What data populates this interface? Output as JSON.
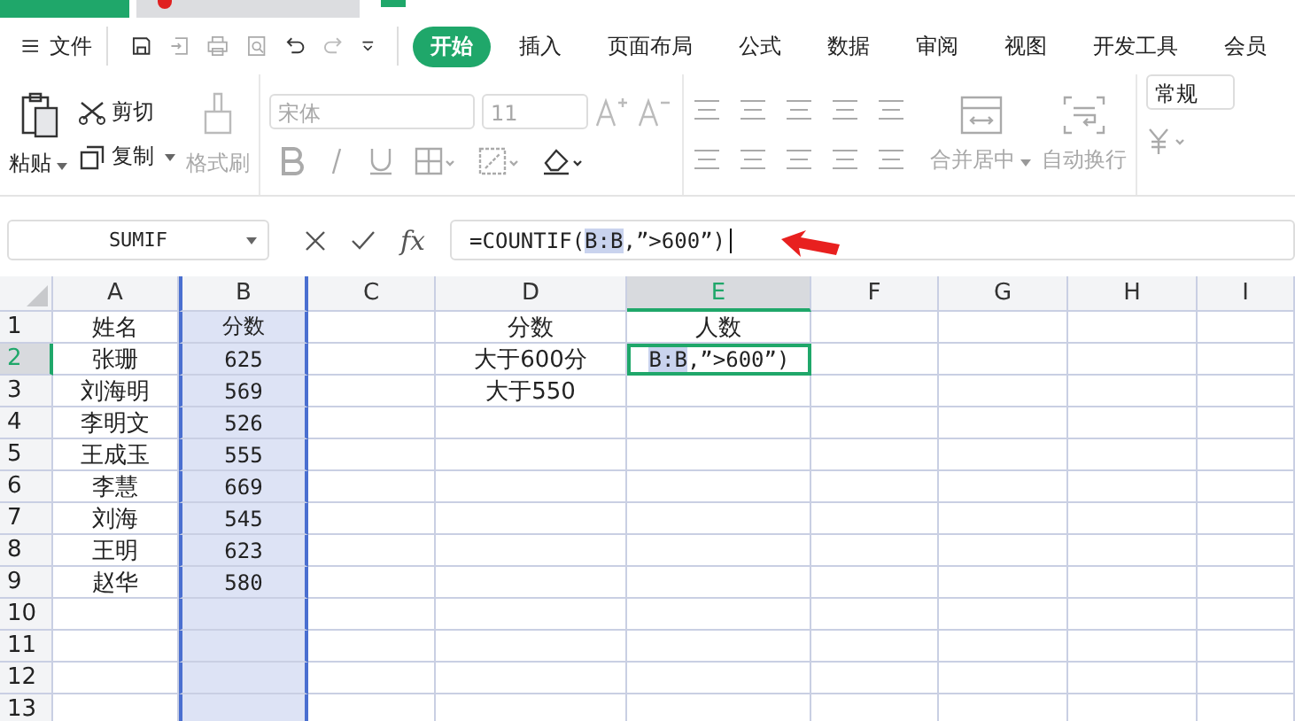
{
  "menu": {
    "file": "文件",
    "tabs": [
      {
        "label": "开始",
        "selected": true
      },
      {
        "label": "插入",
        "selected": false
      },
      {
        "label": "页面布局",
        "selected": false
      },
      {
        "label": "公式",
        "selected": false
      },
      {
        "label": "数据",
        "selected": false
      },
      {
        "label": "审阅",
        "selected": false
      },
      {
        "label": "视图",
        "selected": false
      },
      {
        "label": "开发工具",
        "selected": false
      },
      {
        "label": "会员",
        "selected": false
      }
    ]
  },
  "ribbon": {
    "paste": "粘贴",
    "cut": "剪切",
    "copy": "复制",
    "format_painter": {
      "label": "格式刷",
      "disabled": true
    },
    "font_name": {
      "value": "宋体",
      "disabled": true
    },
    "font_size": {
      "value": "11",
      "disabled": true
    },
    "merge": {
      "label": "合并居中",
      "disabled": true
    },
    "wrap": {
      "label": "自动换行",
      "disabled": true
    },
    "number_format": "常规"
  },
  "formula_bar": {
    "name_box": "SUMIF",
    "fx": "fx",
    "formula": [
      {
        "kind": "text",
        "text": "=COUNTIF("
      },
      {
        "kind": "ref",
        "text": "B:B"
      },
      {
        "kind": "text",
        "text": ",”>600”)"
      }
    ]
  },
  "sheet": {
    "columns": [
      {
        "label": "A",
        "selected": false,
        "referenced": false
      },
      {
        "label": "B",
        "selected": false,
        "referenced": true
      },
      {
        "label": "C",
        "selected": false,
        "referenced": false
      },
      {
        "label": "D",
        "selected": false,
        "referenced": false
      },
      {
        "label": "E",
        "selected": true,
        "referenced": false
      },
      {
        "label": "F",
        "selected": false,
        "referenced": false
      },
      {
        "label": "G",
        "selected": false,
        "referenced": false
      },
      {
        "label": "H",
        "selected": false,
        "referenced": false
      },
      {
        "label": "I",
        "selected": false,
        "referenced": false
      }
    ],
    "rows": [
      {
        "label": "1",
        "selected": false,
        "cells": [
          "姓名",
          "分数",
          "",
          "分数",
          "人数"
        ]
      },
      {
        "label": "2",
        "selected": true,
        "cells": [
          "张珊",
          "625",
          "",
          "大于600分",
          {
            "active": true,
            "parts": [
              {
                "kind": "ref",
                "text": "B:B"
              },
              {
                "kind": "text",
                "text": ",”>600”)"
              }
            ]
          }
        ]
      },
      {
        "label": "3",
        "selected": false,
        "cells": [
          "刘海明",
          "569",
          "",
          "大于550"
        ]
      },
      {
        "label": "4",
        "selected": false,
        "cells": [
          "李明文",
          "526"
        ]
      },
      {
        "label": "5",
        "selected": false,
        "cells": [
          "王成玉",
          "555"
        ]
      },
      {
        "label": "6",
        "selected": false,
        "cells": [
          "李慧",
          "669"
        ]
      },
      {
        "label": "7",
        "selected": false,
        "cells": [
          "刘海",
          "545"
        ]
      },
      {
        "label": "8",
        "selected": false,
        "cells": [
          "王明",
          "623"
        ]
      },
      {
        "label": "9",
        "selected": false,
        "cells": [
          "赵华",
          "580"
        ]
      },
      {
        "label": "10",
        "selected": false,
        "cells": []
      },
      {
        "label": "11",
        "selected": false,
        "cells": []
      },
      {
        "label": "12",
        "selected": false,
        "cells": []
      },
      {
        "label": "13",
        "selected": false,
        "cells": []
      }
    ]
  }
}
